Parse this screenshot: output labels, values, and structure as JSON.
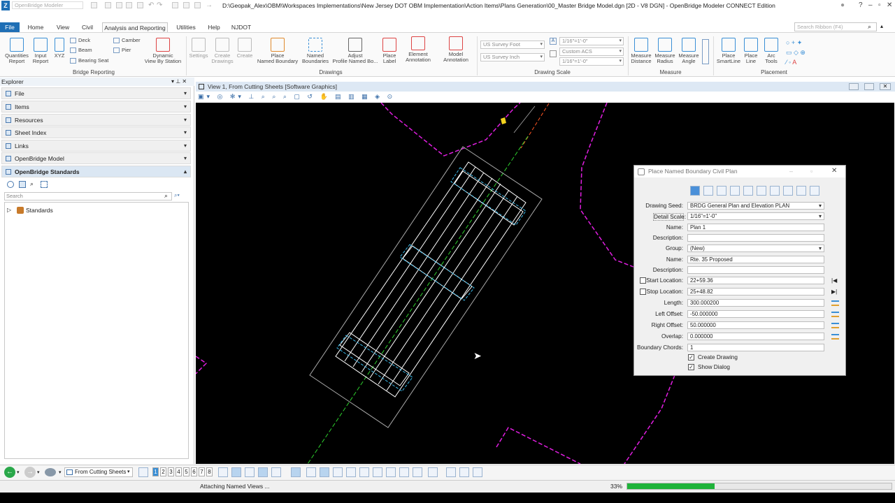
{
  "window": {
    "app_placeholder": "OpenBridge Modeler",
    "title": "D:\\Geopak_Alex\\OBM\\Workspaces Implementations\\New Jersey DOT OBM Implementation\\Action Items\\Plans Generation\\00_Master Bridge Model.dgn [2D - V8 DGN] - OpenBridge Modeler CONNECT Edition"
  },
  "menu": {
    "tabs": [
      "File",
      "Home",
      "View",
      "Civil",
      "Analysis and Reporting",
      "Utilities",
      "Help",
      "NJDOT"
    ],
    "active_tab": "Analysis and Reporting",
    "search_placeholder": "Search Ribbon (F4)"
  },
  "ribbon": {
    "bridge_reporting": {
      "label": "Bridge Reporting",
      "quantities_report": "Quantities\nReport",
      "input_report": "Input\nReport",
      "xyz": "XYZ",
      "deck": "Deck",
      "beam": "Beam",
      "bearing_seat": "Bearing Seat",
      "camber": "Camber",
      "pier": "Pier",
      "dynamic_view": "Dynamic\nView By Station"
    },
    "drawings": {
      "label": "Drawings",
      "settings": "Settings",
      "create_drawings": "Create\nDrawings",
      "create": "Create",
      "place_named_boundary": "Place\nNamed Boundary",
      "named_boundaries": "Named\nBoundaries",
      "adjust_profile": "Adjust\nProfile Named Bo...",
      "place_label": "Place\nLabel",
      "element_annotation": "Element\nAnnotation",
      "model_annotation": "Model\nAnnotation"
    },
    "drawing_scale": {
      "label": "Drawing Scale",
      "unit1": "US Survey Foot",
      "unit2": "US Survey Inch",
      "scale1": "1/16\"=1'-0\"",
      "acs": "Custom ACS",
      "scale2": "1/16\"=1'-0\""
    },
    "measure": {
      "label": "Measure",
      "distance": "Measure\nDistance",
      "radius": "Measure\nRadius",
      "angle": "Measure\nAngle"
    },
    "placement": {
      "label": "Placement",
      "smartline": "Place\nSmartLine",
      "line": "Place\nLine",
      "arc_tools": "Arc\nTools"
    }
  },
  "explorer": {
    "title": "Explorer",
    "sections": [
      "File",
      "Items",
      "Resources",
      "Sheet Index",
      "Links",
      "OpenBridge Model",
      "OpenBridge Standards"
    ],
    "active_section": "OpenBridge Standards",
    "search_placeholder": "Search",
    "tree": [
      "Standards"
    ]
  },
  "view": {
    "title": "View 1, From Cutting Sheets [Software Graphics]"
  },
  "dialog": {
    "title": "Place Named Boundary Civil Plan",
    "fields": {
      "drawing_seed_label": "Drawing Seed:",
      "drawing_seed": "BRDG General Plan and Elevation PLAN",
      "detail_scale_label": "Detail Scale:",
      "detail_scale": "1/16\"=1'-0\"",
      "name_label": "Name:",
      "name": "Plan 1",
      "description_label": "Description:",
      "description": "",
      "group_label": "Group:",
      "group": "(New)",
      "group_name_label": "Name:",
      "group_name": "Rte. 35 Proposed",
      "group_description_label": "Description:",
      "group_description": "",
      "start_location_label": "Start Location:",
      "start_location": "22+59.36",
      "stop_location_label": "Stop Location:",
      "stop_location": "25+48.82",
      "length_label": "Length:",
      "length": "300.000200",
      "left_offset_label": "Left Offset:",
      "left_offset": "-50.000000",
      "right_offset_label": "Right Offset:",
      "right_offset": "50.000000",
      "overlap_label": "Overlap:",
      "overlap": "0.000000",
      "boundary_chords_label": "Boundary Chords:",
      "boundary_chords": "1",
      "create_drawing": "Create Drawing",
      "show_dialog": "Show Dialog"
    },
    "start_location_checked": false,
    "stop_location_checked": false,
    "create_drawing_checked": true,
    "show_dialog_checked": true
  },
  "bottom": {
    "view_selector": "From Cutting Sheets",
    "view_numbers": [
      "1",
      "2",
      "3",
      "4",
      "5",
      "6",
      "7",
      "8"
    ],
    "status": "Attaching Named Views ...",
    "progress_percent": "33%",
    "progress_value": 0.33
  },
  "colors": {
    "accent": "#1f6fb5",
    "alignment_magenta": "#e01ee0",
    "progress_green": "#1fb33a"
  }
}
